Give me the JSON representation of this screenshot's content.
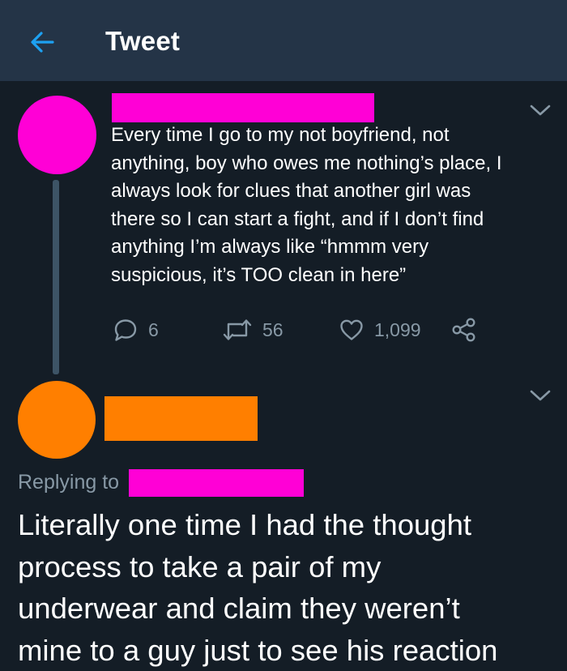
{
  "header": {
    "title": "Tweet",
    "back_icon": "back-arrow-icon",
    "accent_color": "#1da1f2"
  },
  "tweet1": {
    "text": "Every time I go to my not boyfriend, not\nanything, boy who owes me nothing’s place, I\nalways look for clues that another girl was\nthere so I can start a fight, and if I don’t find\nanything I’m always like “hmmm very\nsuspicious, it’s TOO clean in here”",
    "avatar_color": "#ff00d6",
    "name_redaction_color": "#ff00d6",
    "actions": {
      "replies": "6",
      "retweets": "56",
      "likes": "1,099"
    }
  },
  "tweet2": {
    "replying_to_label": "Replying to",
    "text": "Literally one time I had the thought\nprocess to take a pair of my\nunderwear and claim they weren’t\nmine to a guy just to see his reaction",
    "avatar_color": "#ff7f00",
    "name_redaction_color": "#ff7f00",
    "replying_to_redaction_color": "#ff00d6"
  },
  "colors": {
    "background": "#141d26",
    "header_background": "#243447",
    "secondary_text": "#8899a6"
  }
}
